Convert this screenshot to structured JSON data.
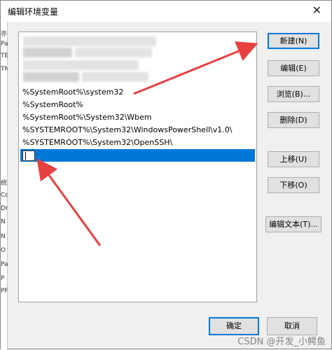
{
  "window": {
    "title": "编辑环境变量",
    "close_glyph": "✕"
  },
  "left_strip": [
    "亦",
    "Pa",
    "TE",
    "TN",
    "",
    "",
    "",
    "",
    "统",
    "Co",
    "Dr",
    "N",
    "N",
    "O",
    "Pa",
    "P",
    "PF"
  ],
  "list": {
    "items": [
      "%SystemRoot%\\system32",
      "%SystemRoot%",
      "%SystemRoot%\\System32\\Wbem",
      "%SYSTEMROOT%\\System32\\WindowsPowerShell\\v1.0\\",
      "%SYSTEMROOT%\\System32\\OpenSSH\\"
    ],
    "editing_value": ""
  },
  "buttons": {
    "new": "新建(N)",
    "edit": "编辑(E)",
    "browse": "浏览(B)...",
    "delete": "删除(D)",
    "move_up": "上移(U)",
    "move_down": "下移(O)",
    "edit_text": "编辑文本(T)...",
    "ok": "确定",
    "cancel": "取消"
  },
  "annotations": {
    "arrow_color": "#e84040"
  },
  "watermark": "CSDN @开发_小鳄鱼"
}
